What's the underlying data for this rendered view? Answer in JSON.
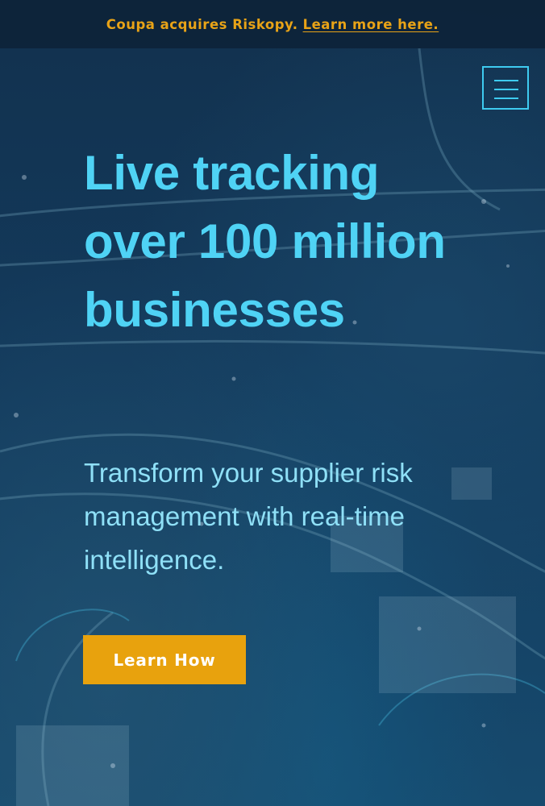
{
  "announcement": {
    "text": "Coupa acquires Riskopy.",
    "link_label": "Learn more here."
  },
  "menu": {
    "icon": "hamburger-menu-icon"
  },
  "hero": {
    "headline": "Live tracking over 100 million businesses",
    "subheadline": "Transform your supplier risk management with real-time intelligence.",
    "cta_label": "Learn How",
    "background": "aerial-city-night-image"
  },
  "colors": {
    "accent_cyan": "#4fd3f5",
    "subtext_cyan": "#8fe0f7",
    "cta_orange": "#e8a20d",
    "announcement_text": "#e8a317",
    "announcement_bg": "#0d2238",
    "hero_bg": "#0e3556"
  }
}
